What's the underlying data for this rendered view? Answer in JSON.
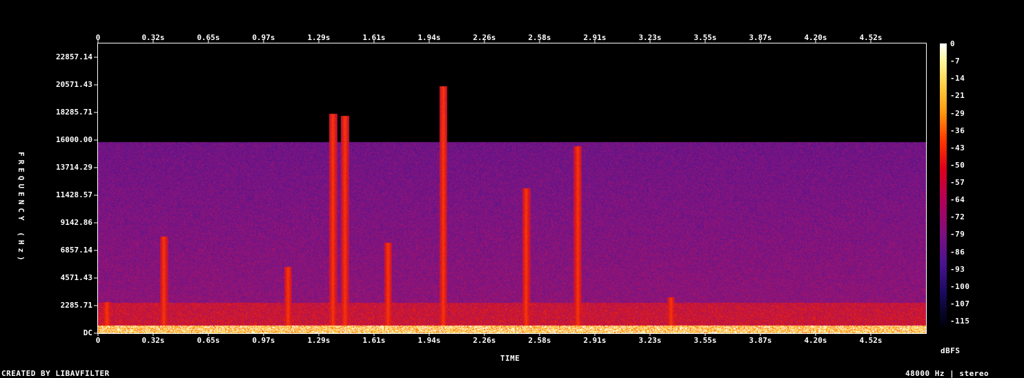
{
  "chart_data": {
    "type": "heatmap",
    "title": "",
    "xlabel": "TIME",
    "ylabel": "FREQUENCY (Hz)",
    "x_ticks": [
      "0",
      "0.32s",
      "0.65s",
      "0.97s",
      "1.29s",
      "1.61s",
      "1.94s",
      "2.26s",
      "2.58s",
      "2.91s",
      "3.23s",
      "3.55s",
      "3.87s",
      "4.20s",
      "4.52s"
    ],
    "y_ticks": [
      "DC",
      "2285.71",
      "4571.43",
      "6857.14",
      "9142.86",
      "11428.57",
      "13714.29",
      "16000.00",
      "18285.71",
      "20571.43",
      "22857.14"
    ],
    "colorbar_ticks": [
      "0",
      "-7",
      "-14",
      "-21",
      "-29",
      "-36",
      "-43",
      "-50",
      "-57",
      "-64",
      "-72",
      "-79",
      "-86",
      "-93",
      "-100",
      "-107",
      "-115"
    ],
    "colorbar_unit": "dBFS",
    "xlim": [
      0,
      4.8
    ],
    "ylim": [
      0,
      24000
    ],
    "noise_ceiling_hz": 15850,
    "events": [
      {
        "t": 0.05,
        "f_max": 2600
      },
      {
        "t": 0.38,
        "f_max": 8000
      },
      {
        "t": 1.1,
        "f_max": 5500
      },
      {
        "t": 1.36,
        "f_max": 18200
      },
      {
        "t": 1.43,
        "f_max": 18000
      },
      {
        "t": 1.68,
        "f_max": 7500
      },
      {
        "t": 2.0,
        "f_max": 20500
      },
      {
        "t": 2.48,
        "f_max": 12000
      },
      {
        "t": 2.78,
        "f_max": 15500
      },
      {
        "t": 3.32,
        "f_max": 3000
      }
    ]
  },
  "footer": {
    "credit": "CREATED BY LIBAVFILTER",
    "format": "48000 Hz | stereo"
  }
}
